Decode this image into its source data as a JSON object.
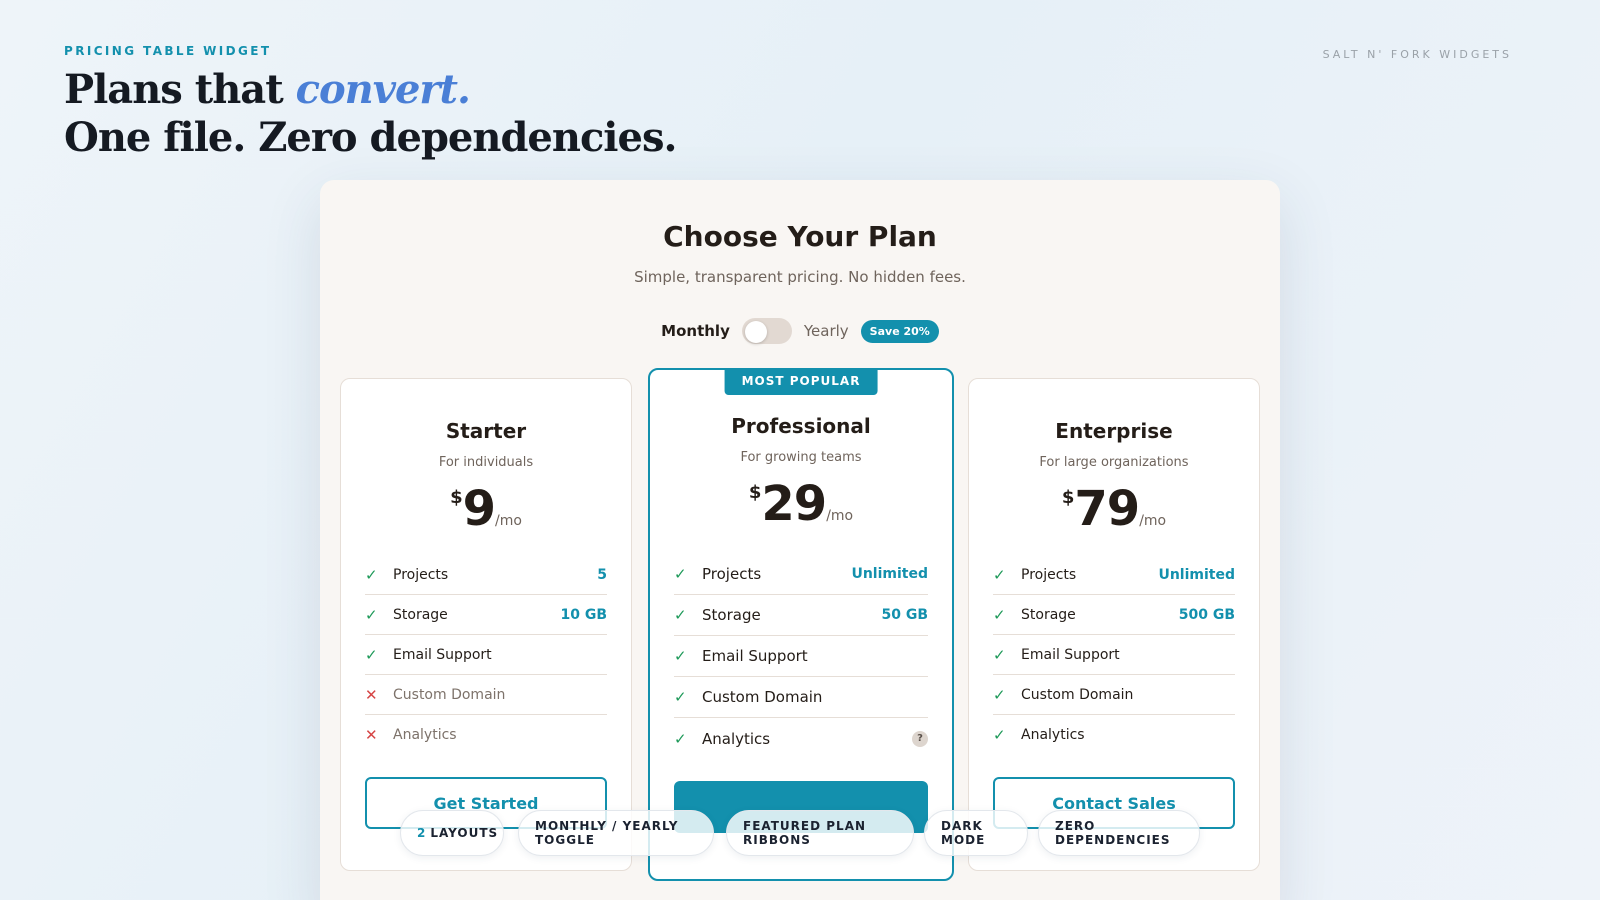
{
  "header": {
    "eyebrow": "PRICING TABLE WIDGET",
    "brand": "SALT N' FORK WIDGETS",
    "headline_line1_plain": "Plans that ",
    "headline_line1_accent": "convert.",
    "headline_line2": "One file. Zero dependencies."
  },
  "panel": {
    "title": "Choose Your Plan",
    "subtitle": "Simple, transparent pricing. No hidden fees.",
    "billing": {
      "monthly_label": "Monthly",
      "yearly_label": "Yearly",
      "save_badge": "Save 20%",
      "selected": "Monthly"
    }
  },
  "plans": [
    {
      "name": "Starter",
      "description": "For individuals",
      "currency": "$",
      "price": "9",
      "period": "/mo",
      "features": [
        {
          "label": "Projects",
          "value": "5",
          "included": true
        },
        {
          "label": "Storage",
          "value": "10 GB",
          "included": true
        },
        {
          "label": "Email Support",
          "value": "",
          "included": true
        },
        {
          "label": "Custom Domain",
          "value": "",
          "included": false
        },
        {
          "label": "Analytics",
          "value": "",
          "included": false
        }
      ],
      "cta": "Get Started"
    },
    {
      "name": "Professional",
      "description": "For growing teams",
      "ribbon": "MOST POPULAR",
      "currency": "$",
      "price": "29",
      "period": "/mo",
      "features": [
        {
          "label": "Projects",
          "value": "Unlimited",
          "included": true
        },
        {
          "label": "Storage",
          "value": "50 GB",
          "included": true
        },
        {
          "label": "Email Support",
          "value": "",
          "included": true
        },
        {
          "label": "Custom Domain",
          "value": "",
          "included": true
        },
        {
          "label": "Analytics",
          "value": "",
          "included": true,
          "help": "?"
        }
      ],
      "cta": ""
    },
    {
      "name": "Enterprise",
      "description": "For large organizations",
      "currency": "$",
      "price": "79",
      "period": "/mo",
      "features": [
        {
          "label": "Projects",
          "value": "Unlimited",
          "included": true
        },
        {
          "label": "Storage",
          "value": "500 GB",
          "included": true
        },
        {
          "label": "Email Support",
          "value": "",
          "included": true
        },
        {
          "label": "Custom Domain",
          "value": "",
          "included": true
        },
        {
          "label": "Analytics",
          "value": "",
          "included": true
        }
      ],
      "cta": "Contact Sales"
    }
  ],
  "icons": {
    "check": "check-icon",
    "cross": "cross-icon",
    "help": "help-icon"
  },
  "colors": {
    "accent": "#1390ad",
    "check": "#1f9a5a",
    "cross": "#d64545"
  },
  "chips": [
    {
      "num": "2",
      "text": "LAYOUTS"
    },
    {
      "num": "",
      "text": "MONTHLY / YEARLY TOGGLE"
    },
    {
      "num": "",
      "text": "FEATURED PLAN RIBBONS"
    },
    {
      "num": "",
      "text": "DARK MODE"
    },
    {
      "num": "",
      "text": "ZERO DEPENDENCIES"
    }
  ]
}
